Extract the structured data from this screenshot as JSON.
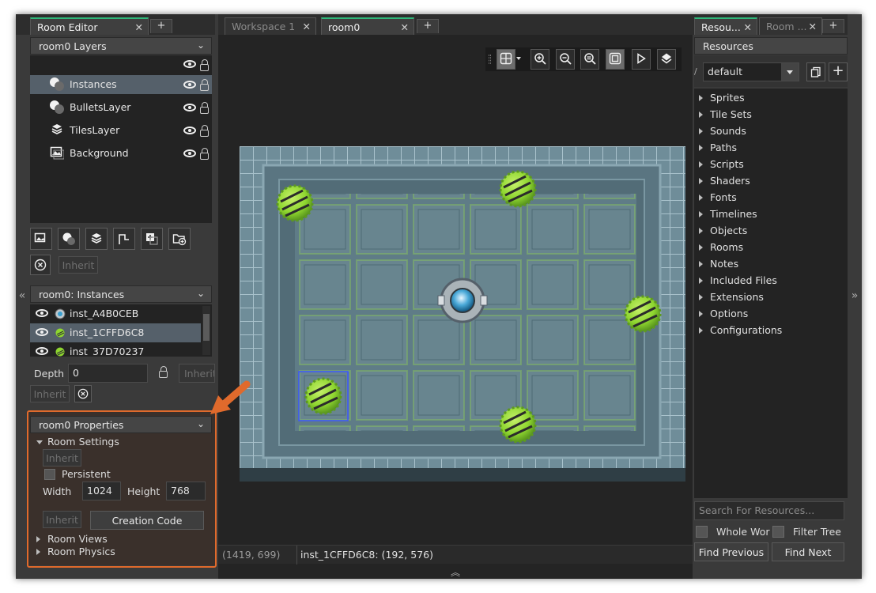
{
  "left_panel": {
    "tab_label": "Room Editor",
    "layers_header": "room0 Layers",
    "layers": [
      {
        "name": "Instances",
        "icon": "instance-layer-icon",
        "selected": true
      },
      {
        "name": "BulletsLayer",
        "icon": "instance-layer-icon",
        "selected": false
      },
      {
        "name": "TilesLayer",
        "icon": "tile-layer-icon",
        "selected": false
      },
      {
        "name": "Background",
        "icon": "background-layer-icon",
        "selected": false
      }
    ],
    "inherit_label": "Inherit",
    "instances_header": "room0: Instances",
    "instances": [
      {
        "name": "inst_A4B0CEB",
        "icon": "player-sprite-icon",
        "selected": false
      },
      {
        "name": "inst_1CFFD6C8",
        "icon": "spiky-sprite-icon",
        "selected": true
      },
      {
        "name": "inst_37D70237",
        "icon": "spiky-sprite-icon",
        "selected": false
      }
    ],
    "depth_label": "Depth",
    "depth_value": "0",
    "properties_header": "room0 Properties",
    "room_settings_label": "Room Settings",
    "persistent_label": "Persistent",
    "width_label": "Width",
    "width_value": "1024",
    "height_label": "Height",
    "height_value": "768",
    "creation_code_label": "Creation Code",
    "room_views_label": "Room Views",
    "room_physics_label": "Room Physics"
  },
  "workspace": {
    "tabs": [
      {
        "label": "Workspace 1",
        "active": false
      },
      {
        "label": "room0",
        "active": true
      }
    ],
    "cursor_coords": "(1419, 699)",
    "status": "inst_1CFFD6C8: (192, 576)"
  },
  "right_panel": {
    "tabs": [
      {
        "label": "Resou...",
        "active": true
      },
      {
        "label": "Room ...",
        "active": false
      }
    ],
    "header": "Resources",
    "dropdown_value": "default",
    "prefix_glyph": "/",
    "tree": [
      "Sprites",
      "Tile Sets",
      "Sounds",
      "Paths",
      "Scripts",
      "Shaders",
      "Fonts",
      "Timelines",
      "Objects",
      "Rooms",
      "Notes",
      "Included Files",
      "Extensions",
      "Options",
      "Configurations"
    ],
    "search_placeholder": "Search For Resources...",
    "whole_word_label": "Whole Worc",
    "filter_tree_label": "Filter Tree",
    "find_previous_label": "Find Previous",
    "find_next_label": "Find Next"
  },
  "glyphs": {
    "close": "✕",
    "plus": "+",
    "collapse_left": "«",
    "collapse_right": "»",
    "expand_up": "︽",
    "chevron_down": "⌄"
  },
  "colors": {
    "accent_green": "#2fb87a",
    "highlight_orange": "#e06a2c",
    "selection": "#55606a",
    "spike_green": "#8ed62f"
  }
}
